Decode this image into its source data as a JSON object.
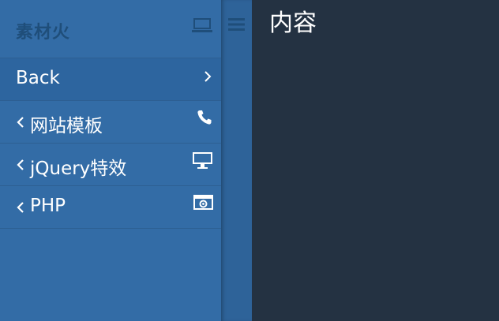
{
  "sidebar": {
    "brand": {
      "title": "素材火",
      "icon": "laptop-icon"
    },
    "items": [
      {
        "label": "Back",
        "icon": "chevron-right-icon"
      },
      {
        "label": "网站模板",
        "icon": "phone-icon"
      },
      {
        "label": "jQuery特效",
        "icon": "desktop-icon"
      },
      {
        "label": "PHP",
        "icon": "camera-icon"
      }
    ]
  },
  "rail": {
    "icon": "hamburger-icon"
  },
  "content": {
    "title": "内容"
  },
  "colors": {
    "sidebar_bg": "#336ca6",
    "rail_bg": "#2e6399",
    "content_bg": "#243242",
    "brand_text": "#1f4e7a"
  }
}
